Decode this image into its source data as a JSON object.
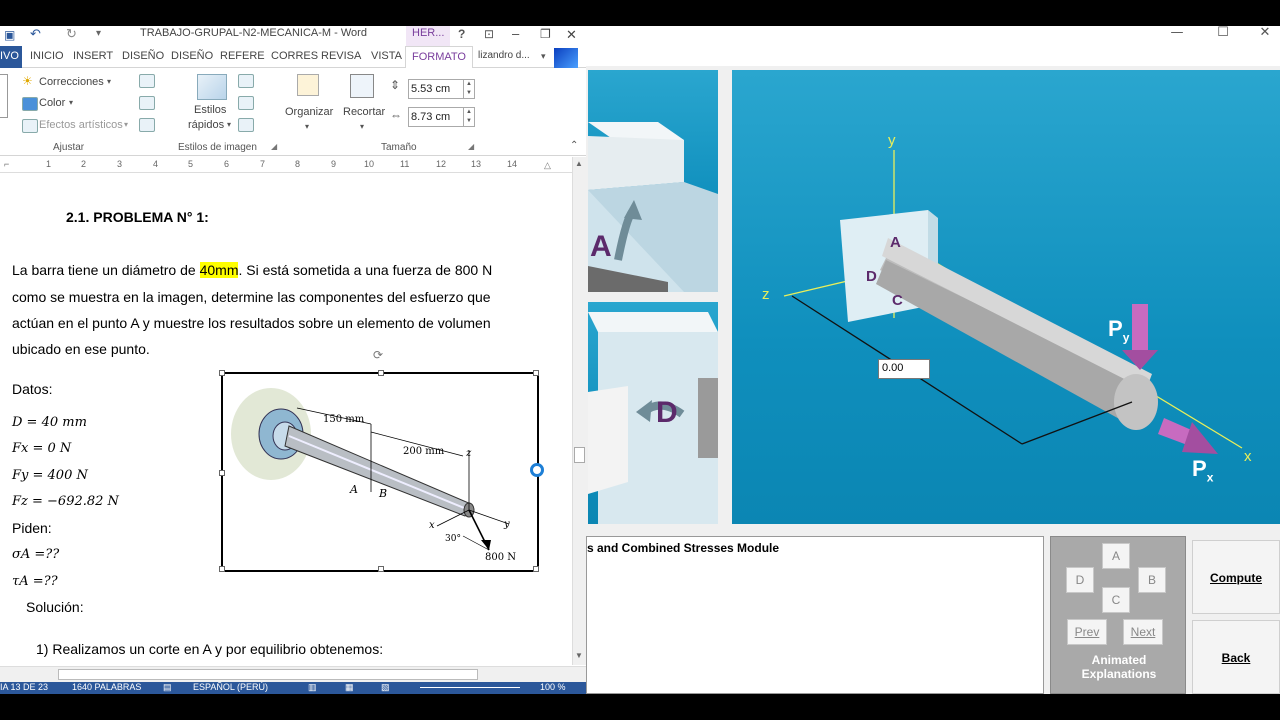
{
  "word": {
    "window_title": "TRABAJO-GRUPAL-N2-MECANICA-M - Word",
    "title_tab_context": "HER...",
    "help": "?",
    "controls": {
      "minimize": "–",
      "restore": "❐",
      "close": "✕"
    },
    "tabs": [
      "IVO",
      "INICIO",
      "INSERT",
      "DISEÑO",
      "DISEÑO",
      "REFERE",
      "CORRES",
      "REVISA",
      "VISTA",
      "FORMATO"
    ],
    "user": "lizandro d...",
    "ribbon": {
      "corrections": "Correcciones",
      "color": "Color",
      "artistic": "Efectos artísticos",
      "group_adjust": "Ajustar",
      "quick_styles_1": "Estilos",
      "quick_styles_2": "rápidos",
      "group_styles": "Estilos de imagen",
      "organize": "Organizar",
      "crop": "Recortar",
      "height": "5.53 cm",
      "width": "8.73 cm",
      "group_size": "Tamaño"
    },
    "ruler": [
      "1",
      "2",
      "3",
      "4",
      "5",
      "6",
      "7",
      "8",
      "9",
      "10",
      "11",
      "12",
      "13",
      "14"
    ],
    "document": {
      "heading": "2.1.  PROBLEMA N° 1:",
      "para_pre": "La barra tiene un diámetro de ",
      "para_hl": "40mm",
      "para_post": ". Si está sometida a una fuerza de 800 N",
      "para_line2": "como se muestra en la imagen, determine las componentes del esfuerzo que",
      "para_line3": "actúan en el punto A y muestre los resultados sobre un elemento de volumen",
      "para_line4": "ubicado en ese punto.",
      "datos": "Datos:",
      "d": "D = 40 mm",
      "fx": "Fx = 0 N",
      "fy": "Fy = 400 N",
      "fz": "Fz = −692.82 N",
      "piden": "Piden:",
      "sigma": "σA =??",
      "tau": "τA =??",
      "solucion": "Solución:",
      "step1": "1)  Realizamos un corte en A y por equilibrio obtenemos:",
      "figure": {
        "dim_150": "150 mm",
        "dim_200": "200 mm",
        "label_z": "z",
        "label_x": "x",
        "label_y": "y",
        "label_a": "A",
        "label_b": "B",
        "angle": "30°",
        "force": "800 N"
      }
    },
    "status": {
      "page": "IA 13 DE 23",
      "words": "1640 PALABRAS",
      "lang": "ESPAÑOL (PERÚ)",
      "zoom": "100 %"
    }
  },
  "app": {
    "controls": {
      "minimize": "—",
      "restore": "☐",
      "close": "✕"
    },
    "distance_input": "0.00",
    "info_title": "s and Combined Stresses Module",
    "scene": {
      "axis_y": "y",
      "axis_z": "z",
      "axis_x": "x",
      "point_a": "A",
      "point_d": "D",
      "point_c": "C",
      "py": "P",
      "py_sub": "y",
      "px": "P",
      "px_sub": "x",
      "left_a": "A",
      "left_d": "D"
    },
    "nav": {
      "a": "A",
      "b": "B",
      "c": "C",
      "d": "D",
      "prev": "Prev",
      "next": "Next",
      "label_1": "Animated",
      "label_2": "Explanations"
    },
    "compute": "Compute",
    "back": "Back"
  }
}
